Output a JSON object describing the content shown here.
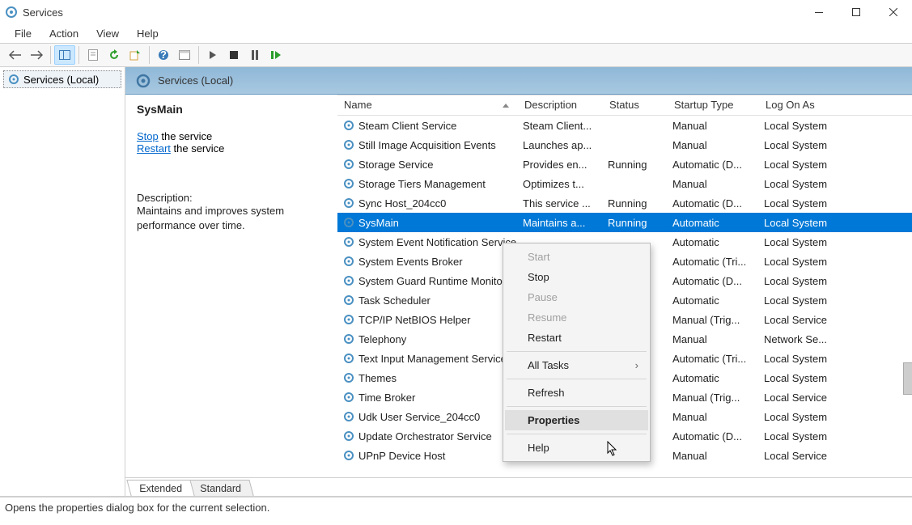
{
  "window": {
    "title": "Services"
  },
  "menu": {
    "file": "File",
    "action": "Action",
    "view": "View",
    "help": "Help"
  },
  "tree": {
    "root": "Services (Local)"
  },
  "header": {
    "title": "Services (Local)"
  },
  "detail": {
    "title": "SysMain",
    "stop_label": "Stop",
    "stop_suffix": " the service",
    "restart_label": "Restart",
    "restart_suffix": " the service",
    "desc_label": "Description:",
    "desc_text": "Maintains and improves system performance over time."
  },
  "columns": {
    "name": "Name",
    "description": "Description",
    "status": "Status",
    "startup": "Startup Type",
    "logon": "Log On As"
  },
  "services": [
    {
      "name": "Steam Client Service",
      "desc": "Steam Client...",
      "status": "",
      "start": "Manual",
      "logon": "Local System"
    },
    {
      "name": "Still Image Acquisition Events",
      "desc": "Launches ap...",
      "status": "",
      "start": "Manual",
      "logon": "Local System"
    },
    {
      "name": "Storage Service",
      "desc": "Provides en...",
      "status": "Running",
      "start": "Automatic (D...",
      "logon": "Local System"
    },
    {
      "name": "Storage Tiers Management",
      "desc": "Optimizes t...",
      "status": "",
      "start": "Manual",
      "logon": "Local System"
    },
    {
      "name": "Sync Host_204cc0",
      "desc": "This service ...",
      "status": "Running",
      "start": "Automatic (D...",
      "logon": "Local System"
    },
    {
      "name": "SysMain",
      "desc": "Maintains a...",
      "status": "Running",
      "start": "Automatic",
      "logon": "Local System",
      "selected": true
    },
    {
      "name": "System Event Notification Service",
      "desc": "",
      "status": "",
      "start": "Automatic",
      "logon": "Local System"
    },
    {
      "name": "System Events Broker",
      "desc": "",
      "status": "",
      "start": "Automatic (Tri...",
      "logon": "Local System"
    },
    {
      "name": "System Guard Runtime Monitor",
      "desc": "",
      "status": "",
      "start": "Automatic (D...",
      "logon": "Local System"
    },
    {
      "name": "Task Scheduler",
      "desc": "",
      "status": "",
      "start": "Automatic",
      "logon": "Local System"
    },
    {
      "name": "TCP/IP NetBIOS Helper",
      "desc": "",
      "status": "",
      "start": "Manual (Trig...",
      "logon": "Local Service"
    },
    {
      "name": "Telephony",
      "desc": "",
      "status": "",
      "start": "Manual",
      "logon": "Network Se..."
    },
    {
      "name": "Text Input Management Service",
      "desc": "",
      "status": "",
      "start": "Automatic (Tri...",
      "logon": "Local System"
    },
    {
      "name": "Themes",
      "desc": "",
      "status": "",
      "start": "Automatic",
      "logon": "Local System"
    },
    {
      "name": "Time Broker",
      "desc": "",
      "status": "",
      "start": "Manual (Trig...",
      "logon": "Local Service"
    },
    {
      "name": "Udk User Service_204cc0",
      "desc": "",
      "status": "",
      "start": "Manual",
      "logon": "Local System"
    },
    {
      "name": "Update Orchestrator Service",
      "desc": "",
      "status": "",
      "start": "Automatic (D...",
      "logon": "Local System"
    },
    {
      "name": "UPnP Device Host",
      "desc": "",
      "status": "",
      "start": "Manual",
      "logon": "Local Service"
    }
  ],
  "context_menu": {
    "start": "Start",
    "stop": "Stop",
    "pause": "Pause",
    "resume": "Resume",
    "restart": "Restart",
    "all_tasks": "All Tasks",
    "refresh": "Refresh",
    "properties": "Properties",
    "help": "Help"
  },
  "tabs": {
    "extended": "Extended",
    "standard": "Standard"
  },
  "status_text": "Opens the properties dialog box for the current selection."
}
